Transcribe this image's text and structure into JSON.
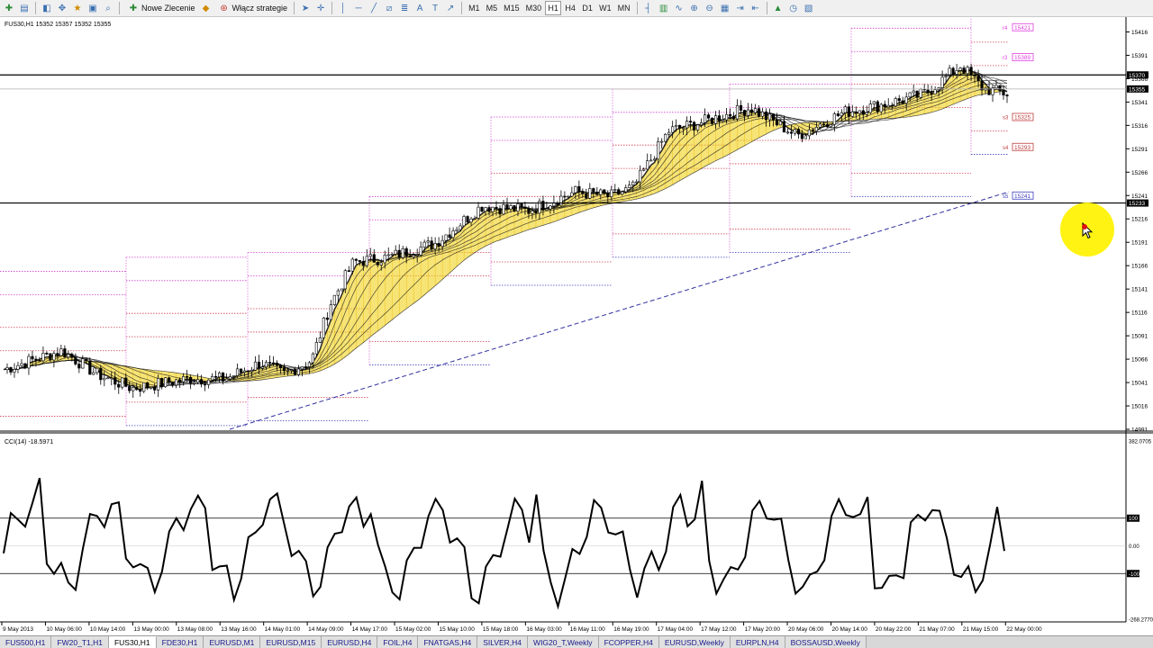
{
  "toolbar": {
    "new_order_label": "Nowe Zlecenie",
    "strategies_label": "Włącz strategie",
    "timeframes": [
      "M1",
      "M5",
      "M15",
      "M30",
      "H1",
      "H4",
      "D1",
      "W1",
      "MN"
    ],
    "active_timeframe": "H1"
  },
  "main_chart": {
    "title": "FUS30,H1  15352 15357 15352 15355",
    "price_axis": [
      "15416",
      "15391",
      "15366",
      "15341",
      "15316",
      "15291",
      "15266",
      "15241",
      "15216",
      "15191",
      "15166",
      "15141",
      "15116",
      "15091",
      "15066",
      "15041",
      "15016",
      "14991"
    ],
    "price_range": [
      14991,
      15428
    ],
    "current_price_label": "15355",
    "hline_upper_label": "15370",
    "hline_lower_label": "15233",
    "hline_upper_value": 15370,
    "hline_lower_value": 15233,
    "levels": [
      {
        "prefix": "r4",
        "label": "15421",
        "value": 15421,
        "color": "#e040e0"
      },
      {
        "prefix": "r3",
        "label": "15389",
        "value": 15389,
        "color": "#e040e0"
      },
      {
        "prefix": "s3",
        "label": "15325",
        "value": 15325,
        "color": "#c04040"
      },
      {
        "prefix": "s4",
        "label": "15293",
        "value": 15293,
        "color": "#c04040"
      },
      {
        "prefix": "s5",
        "label": "15241",
        "value": 15241,
        "color": "#4040c0"
      }
    ]
  },
  "indicator": {
    "title": "CCI(14) -18.5971",
    "axis_top": "382.0705",
    "axis_upper": "100",
    "axis_zero": "0.00",
    "axis_lower": "-100",
    "axis_bottom": "-268.2770",
    "range": [
      -268.277,
      382.0705
    ]
  },
  "time_axis": [
    "9 May 2013",
    "10 May 06:00",
    "10 May 14:00",
    "13 May 00:00",
    "13 May 08:00",
    "13 May 16:00",
    "14 May 01:00",
    "14 May 09:00",
    "14 May 17:00",
    "15 May 02:00",
    "15 May 10:00",
    "15 May 18:00",
    "16 May 03:00",
    "16 May 11:00",
    "16 May 19:00",
    "17 May 04:00",
    "17 May 12:00",
    "17 May 20:00",
    "20 May 06:00",
    "20 May 14:00",
    "20 May 22:00",
    "21 May 07:00",
    "21 May 15:00",
    "22 May 00:00"
  ],
  "tabs": [
    "FUS500,H1",
    "FW20_T1,H1",
    "FUS30,H1",
    "FDE30,H1",
    "EURUSD,M1",
    "EURUSD,M15",
    "EURUSD,H4",
    "FOIL,H4",
    "FNATGAS,H4",
    "SILVER,H4",
    "WIG20_T,Weekly",
    "FCOPPER,H4",
    "EURUSD,Weekly",
    "EURPLN,H4",
    "BOSSAUSD,Weekly"
  ],
  "active_tab": "FUS30,H1",
  "colors": {
    "candle": "#000000",
    "ribbon_dark": "#111111",
    "ribbon_fill": "#f2d21a",
    "hline": "#000000",
    "trendline": "#3030a0",
    "pivot_magenta": "#d040d0",
    "pivot_red": "#d04050",
    "pivot_blue": "#4040c0",
    "cursor_highlight": "#fff200"
  }
}
